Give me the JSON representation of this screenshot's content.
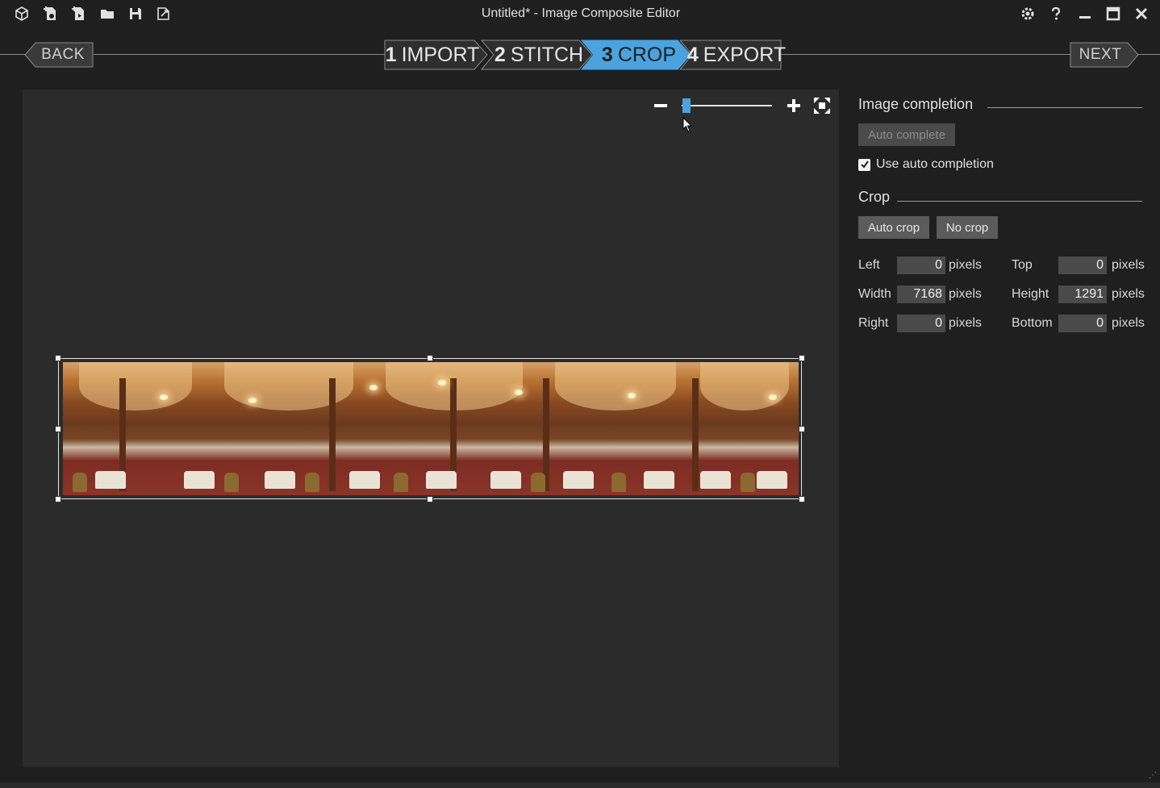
{
  "window": {
    "title": "Untitled* - Image Composite Editor"
  },
  "nav": {
    "back_label": "BACK",
    "next_label": "NEXT",
    "steps": [
      {
        "num": "1",
        "label": "IMPORT"
      },
      {
        "num": "2",
        "label": "STITCH"
      },
      {
        "num": "3",
        "label": "CROP"
      },
      {
        "num": "4",
        "label": "EXPORT"
      }
    ],
    "active_step": 3
  },
  "toolbar": {
    "icons": [
      "app-cube-icon",
      "new-panorama-from-images-icon",
      "new-panorama-from-video-icon",
      "open-folder-icon",
      "save-icon",
      "export-icon"
    ],
    "right_icons": [
      "settings-icon",
      "help-icon",
      "minimize-icon",
      "maximize-icon",
      "close-icon"
    ]
  },
  "zoom": {
    "level": 0.03
  },
  "image_completion": {
    "title": "Image completion",
    "auto_complete_label": "Auto complete",
    "use_auto_completion_label": "Use auto completion",
    "use_auto_completion_checked": true
  },
  "crop": {
    "title": "Crop",
    "auto_crop_label": "Auto crop",
    "no_crop_label": "No crop",
    "unit": "pixels",
    "fields": {
      "left": {
        "label": "Left",
        "value": "0"
      },
      "top": {
        "label": "Top",
        "value": "0"
      },
      "width": {
        "label": "Width",
        "value": "7168"
      },
      "height": {
        "label": "Height",
        "value": "1291"
      },
      "right": {
        "label": "Right",
        "value": "0"
      },
      "bottom": {
        "label": "Bottom",
        "value": "0"
      }
    }
  },
  "colors": {
    "accent": "#4aa3df",
    "background": "#1f1f1f",
    "canvas": "#2b2b2b"
  }
}
